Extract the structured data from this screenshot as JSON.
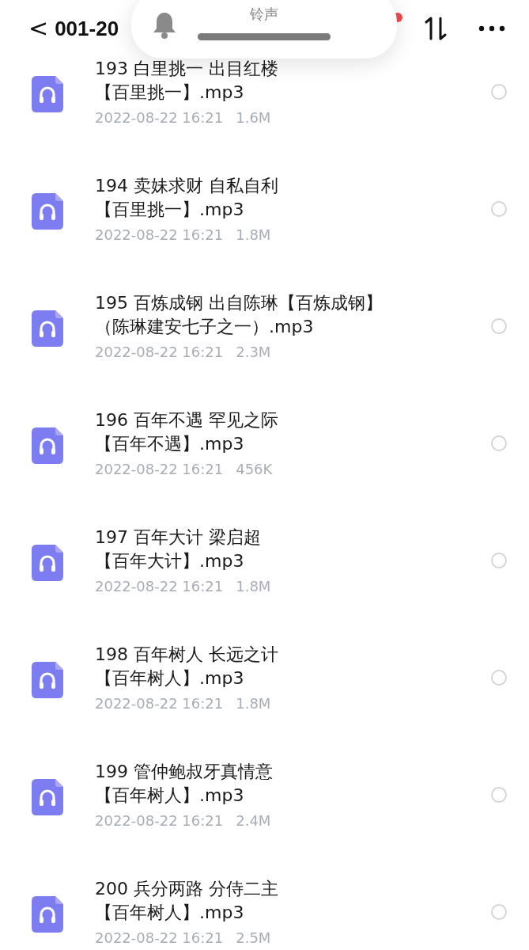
{
  "header": {
    "back": "<",
    "title": "001-20"
  },
  "ringtone_popup": {
    "label": "铃声",
    "level": 1
  },
  "files": [
    {
      "title": "193 白里挑一 出目红楼",
      "subtitle": "【百里挑一】.mp3",
      "date": "2022-08-22 16:21",
      "size": "1.6M",
      "selected": false
    },
    {
      "title": "194 卖妹求财 自私自利",
      "subtitle": "【百里挑一】.mp3",
      "date": "2022-08-22 16:21",
      "size": "1.8M",
      "selected": false
    },
    {
      "title": "195 百炼成钢 出自陈琳【百炼成钢】",
      "subtitle": "（陈琳建安七子之一）.mp3",
      "date": "2022-08-22 16:21",
      "size": "2.3M",
      "selected": false
    },
    {
      "title": "196 百年不遇 罕见之际",
      "subtitle": "【百年不遇】.mp3",
      "date": "2022-08-22 16:21",
      "size": "456K",
      "selected": false
    },
    {
      "title": "197 百年大计 梁启超",
      "subtitle": "【百年大计】.mp3",
      "date": "2022-08-22 16:21",
      "size": "1.8M",
      "selected": false
    },
    {
      "title": "198 百年树人 长远之计",
      "subtitle": "【百年树人】.mp3",
      "date": "2022-08-22 16:21",
      "size": "1.8M",
      "selected": false
    },
    {
      "title": "199 管仲鲍叔牙真情意",
      "subtitle": "【百年树人】.mp3",
      "date": "2022-08-22 16:21",
      "size": "2.4M",
      "selected": false
    },
    {
      "title": "200 兵分两路 分侍二主",
      "subtitle": "【百年树人】.mp3",
      "date": "2022-08-22 16:21",
      "size": "2.5M",
      "selected": false
    }
  ]
}
